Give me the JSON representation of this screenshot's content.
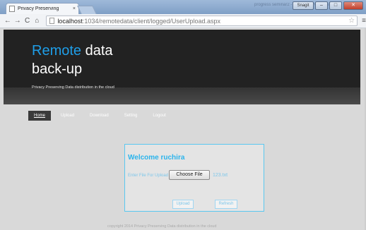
{
  "browser": {
    "tab_title": "Privacy Preserving",
    "tab_close": "×",
    "window_title_blur": "progress seminar2 - Microsoft PowerPoint",
    "extra_button": "Snagit",
    "url_host": "localhost",
    "url_path": ":1034/remotedata/client/logged/UserUpload.aspx"
  },
  "header": {
    "logo_accent": "Remote",
    "logo_rest": " data",
    "logo_line2": "back-up",
    "tagline": "Privacy Preserving Data distribution in the cloud"
  },
  "nav": {
    "items": [
      "Home",
      "Upload",
      "Download",
      "Setting",
      "Logout"
    ]
  },
  "upload": {
    "welcome": "Welcome ruchira",
    "file_label": "Enter File For Upload",
    "choose_button": "Choose File",
    "file_name": "123.txt",
    "upload_button": "Upload",
    "refresh_button": "Refresh"
  },
  "footer": {
    "text": "copyright 2014 Privacy Preserving Data distribution in the cloud"
  }
}
